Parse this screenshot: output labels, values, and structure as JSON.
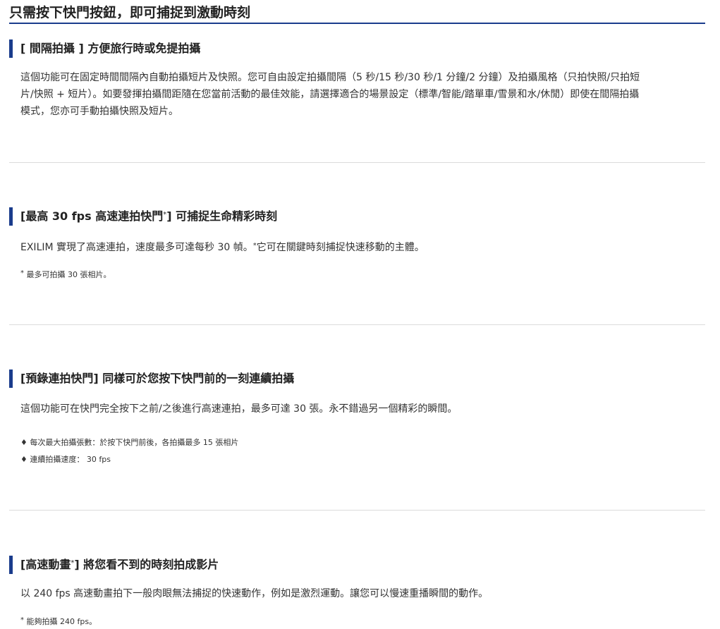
{
  "page": {
    "title": "只需按下快門按鈕，即可捕捉到激動時刻"
  },
  "sections": [
    {
      "title": "[ 間隔拍攝 ] 方便旅行時或免提拍攝",
      "body_lines": [
        "這個功能可在固定時間間隔內自動拍攝短片及快照。您可自由設定拍攝間隔（5 秒/15 秒/30 秒/1 分鐘/2 分鐘）及拍攝風格（只拍快照/只拍短",
        "片/快照 + 短片）。如要發揮拍攝間距隨在您當前活動的最佳效能，請選擇適合的場景設定（標準/智能/踏單車/雪景和水/休閒）即使在間隔拍攝",
        "模式，您亦可手動拍攝快照及短片。"
      ]
    },
    {
      "title_pre": "[最高 30 fps 高速連拍快門",
      "title_sup": "*",
      "title_post": "] 可捕捉生命精彩時刻",
      "body_pre": "EXILIM 實現了高速連拍，速度最多可達每秒 30 幀。",
      "body_sup": "*",
      "body_post": "它可在關鍵時刻捕捉快速移動的主體。",
      "note_mark": "*",
      "note": " 最多可拍攝 30 張相片。"
    },
    {
      "title": "[預錄連拍快門] 同樣可於您按下快門前的一刻連續拍攝",
      "body": "這個功能可在快門完全按下之前/之後進行高速連拍，最多可達 30 張。永不錯過另一個精彩的瞬間。",
      "bullets": [
        "♦ 每次最大拍攝張數：於按下快門前後，各拍攝最多 15 張相片",
        "♦ 連續拍攝速度： 30 fps"
      ]
    },
    {
      "title_pre": "[高速動畫",
      "title_sup": "*",
      "title_post": "] 將您看不到的時刻拍成影片",
      "body": "以 240 fps 高速動畫拍下一般肉眼無法捕捉的快速動作，例如是激烈運動。讓您可以慢速重播瞬間的動作。",
      "note_mark": "*",
      "note": " 能夠拍攝 240 fps。"
    }
  ],
  "colors": {
    "accent": "#1a3c8c",
    "divider": "#dcdcdc",
    "text": "#333333"
  }
}
